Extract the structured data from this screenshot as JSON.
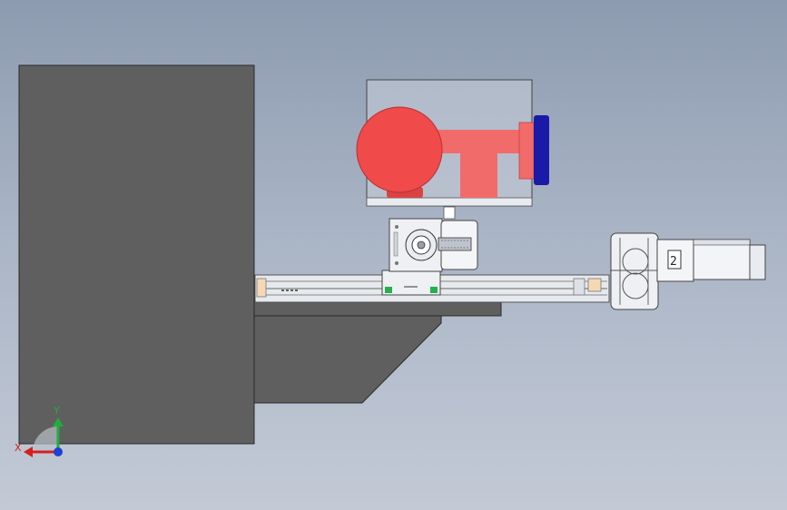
{
  "triad": {
    "x_label": "X",
    "y_label": "Y"
  },
  "colors": {
    "background_top": "#8d9bb0",
    "background_bottom": "#c3cad6",
    "base_block": "#5f5f5f",
    "red_body": "#f04a4a",
    "red_pipe": "#f26b6b",
    "blue_flange": "#1a1aa8",
    "rail": "#e6e9ee",
    "green_mark": "#22b14c",
    "motor_body": "#f2f4f7",
    "axis_x": "#d61f1f",
    "axis_y": "#1fae3a",
    "axis_z": "#1f3fd6"
  },
  "icons": {
    "triad": "coordinate-triad-icon"
  }
}
